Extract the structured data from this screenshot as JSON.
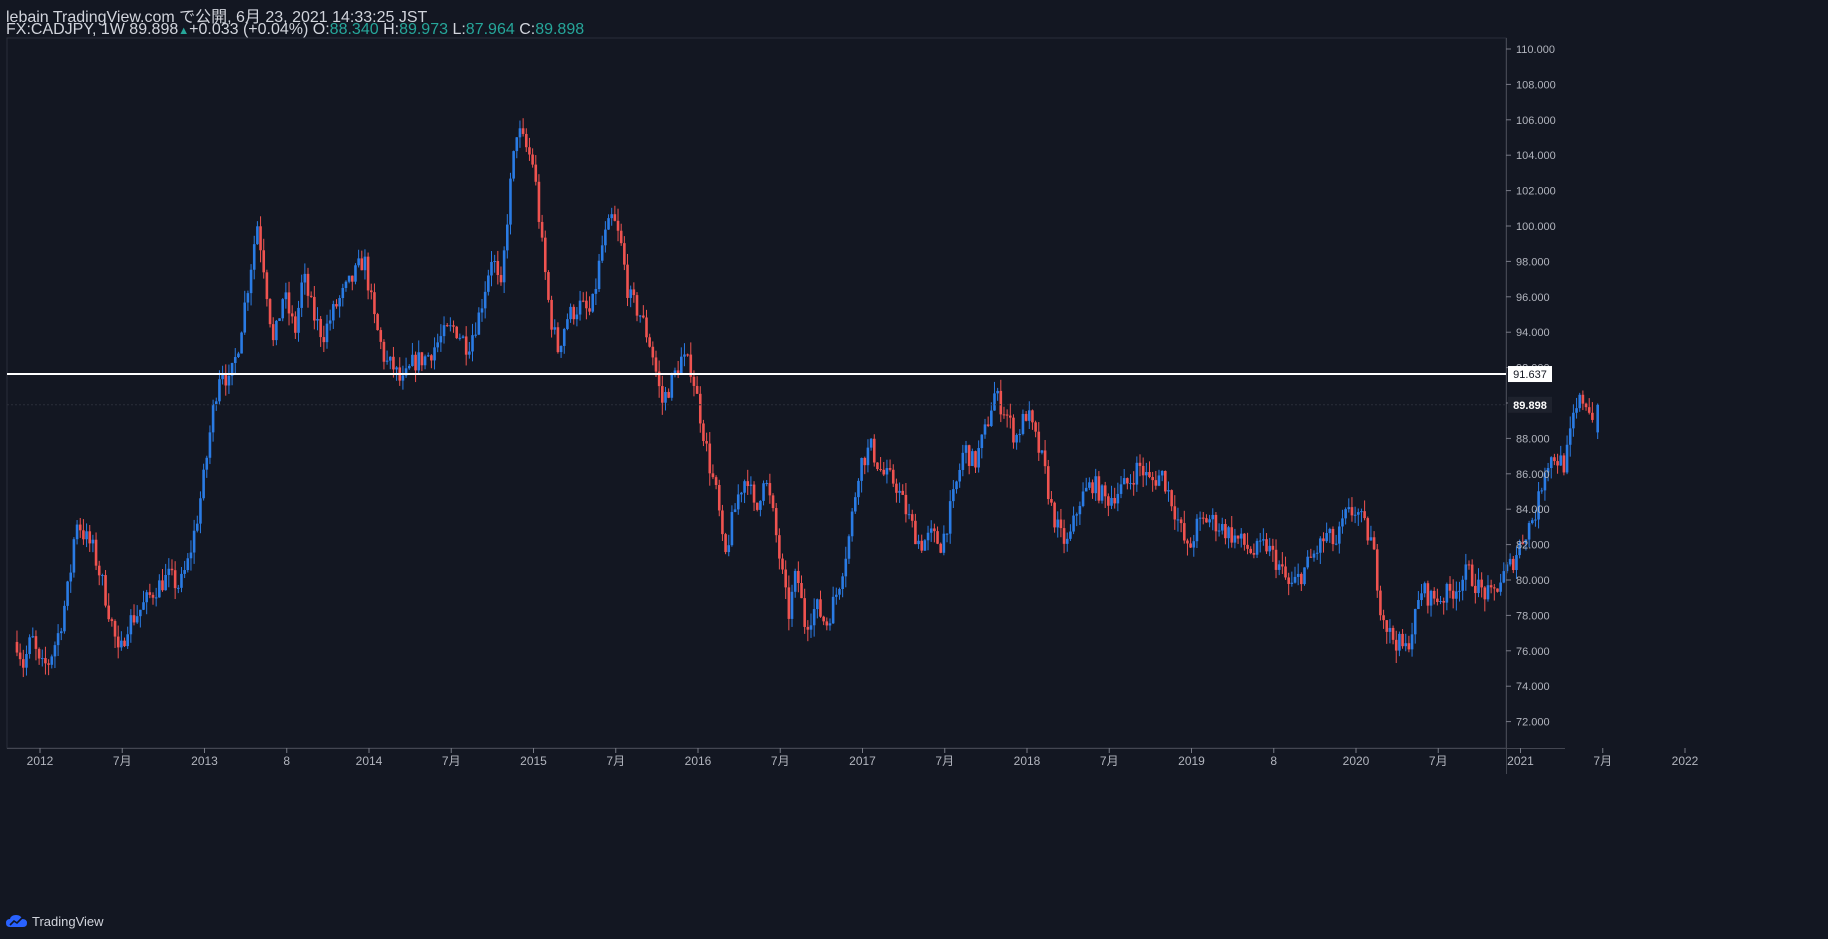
{
  "header": {
    "line1": "lebain TradingView.com で公開, 6月 23, 2021 14:33:25 JST",
    "symbol": "FX:CADJPY, 1W",
    "last": "89.898",
    "change": "+0.033 (+0.04%)",
    "o_label": "O:",
    "o": "88.340",
    "h_label": "H:",
    "h": "89.973",
    "l_label": "L:",
    "l": "87.964",
    "c_label": "C:",
    "c": "89.898"
  },
  "footer": {
    "brand": "TradingView"
  },
  "colors": {
    "background": "#131722",
    "up": "#2a7be4",
    "down": "#ef5350",
    "text": "#d1d4dc",
    "value": "#26a69a",
    "hline": "#ffffff"
  },
  "chart_data": {
    "type": "candlestick",
    "symbol": "FX:CADJPY",
    "interval": "1W",
    "ylim": [
      70,
      111
    ],
    "y_ticks": [
      "72.000",
      "74.000",
      "76.000",
      "78.000",
      "80.000",
      "82.000",
      "84.000",
      "86.000",
      "88.000",
      "90.000",
      "92.000",
      "94.000",
      "96.000",
      "98.000",
      "100.000",
      "102.000",
      "104.000",
      "106.000",
      "108.000",
      "110.000"
    ],
    "x_ticks": [
      {
        "label": "2012",
        "x": 2012.0
      },
      {
        "label": "7月",
        "x": 2012.5
      },
      {
        "label": "2013",
        "x": 2013.0
      },
      {
        "label": "8",
        "x": 2013.5
      },
      {
        "label": "2014",
        "x": 2014.0
      },
      {
        "label": "7月",
        "x": 2014.5
      },
      {
        "label": "2015",
        "x": 2015.0
      },
      {
        "label": "7月",
        "x": 2015.5
      },
      {
        "label": "2016",
        "x": 2016.0
      },
      {
        "label": "7月",
        "x": 2016.5
      },
      {
        "label": "2017",
        "x": 2017.0
      },
      {
        "label": "7月",
        "x": 2017.5
      },
      {
        "label": "2018",
        "x": 2018.0
      },
      {
        "label": "7月",
        "x": 2018.5
      },
      {
        "label": "2019",
        "x": 2019.0
      },
      {
        "label": "8",
        "x": 2019.5
      },
      {
        "label": "2020",
        "x": 2020.0
      },
      {
        "label": "7月",
        "x": 2020.5
      },
      {
        "label": "2021",
        "x": 2021.0
      },
      {
        "label": "7月",
        "x": 2021.5
      },
      {
        "label": "2022",
        "x": 2022.0
      }
    ],
    "horizontal_line": {
      "value": 91.637,
      "label": "91.637"
    },
    "last_price": {
      "value": 89.898,
      "label": "89.898"
    },
    "path": [
      [
        2011.86,
        76.5
      ],
      [
        2011.9,
        75.2
      ],
      [
        2011.95,
        76.8
      ],
      [
        2012.0,
        75.0
      ],
      [
        2012.05,
        75.3
      ],
      [
        2012.12,
        77.2
      ],
      [
        2012.18,
        80.0
      ],
      [
        2012.22,
        83.5
      ],
      [
        2012.27,
        82.5
      ],
      [
        2012.32,
        81.8
      ],
      [
        2012.38,
        79.8
      ],
      [
        2012.45,
        77.0
      ],
      [
        2012.48,
        75.5
      ],
      [
        2012.53,
        77.5
      ],
      [
        2012.6,
        78.2
      ],
      [
        2012.7,
        79.5
      ],
      [
        2012.78,
        80.2
      ],
      [
        2012.85,
        79.6
      ],
      [
        2012.9,
        81.0
      ],
      [
        2012.95,
        83.2
      ],
      [
        2013.0,
        86.0
      ],
      [
        2013.05,
        89.5
      ],
      [
        2013.1,
        92.2
      ],
      [
        2013.15,
        91.0
      ],
      [
        2013.2,
        93.0
      ],
      [
        2013.27,
        97.0
      ],
      [
        2013.32,
        100.2
      ],
      [
        2013.36,
        97.8
      ],
      [
        2013.42,
        93.2
      ],
      [
        2013.48,
        96.2
      ],
      [
        2013.55,
        94.0
      ],
      [
        2013.6,
        97.2
      ],
      [
        2013.66,
        95.0
      ],
      [
        2013.72,
        93.8
      ],
      [
        2013.8,
        95.5
      ],
      [
        2013.9,
        97.0
      ],
      [
        2013.97,
        98.2
      ],
      [
        2014.03,
        94.8
      ],
      [
        2014.1,
        92.3
      ],
      [
        2014.15,
        92.0
      ],
      [
        2014.2,
        91.0
      ],
      [
        2014.27,
        92.3
      ],
      [
        2014.35,
        92.6
      ],
      [
        2014.45,
        93.8
      ],
      [
        2014.52,
        94.3
      ],
      [
        2014.6,
        93.2
      ],
      [
        2014.67,
        95.0
      ],
      [
        2014.75,
        98.5
      ],
      [
        2014.8,
        96.0
      ],
      [
        2014.85,
        101.5
      ],
      [
        2014.9,
        105.5
      ],
      [
        2014.95,
        104.5
      ],
      [
        2015.0,
        103.5
      ],
      [
        2015.05,
        99.0
      ],
      [
        2015.1,
        95.0
      ],
      [
        2015.15,
        93.0
      ],
      [
        2015.2,
        94.8
      ],
      [
        2015.28,
        95.5
      ],
      [
        2015.35,
        95.0
      ],
      [
        2015.42,
        99.0
      ],
      [
        2015.48,
        100.5
      ],
      [
        2015.53,
        99.0
      ],
      [
        2015.58,
        96.0
      ],
      [
        2015.65,
        95.0
      ],
      [
        2015.72,
        93.0
      ],
      [
        2015.78,
        90.0
      ],
      [
        2015.83,
        91.0
      ],
      [
        2015.9,
        92.5
      ],
      [
        2015.96,
        92.0
      ],
      [
        2016.02,
        89.0
      ],
      [
        2016.07,
        86.5
      ],
      [
        2016.12,
        84.5
      ],
      [
        2016.16,
        81.0
      ],
      [
        2016.2,
        83.0
      ],
      [
        2016.25,
        85.0
      ],
      [
        2016.3,
        86.0
      ],
      [
        2016.35,
        83.5
      ],
      [
        2016.4,
        86.0
      ],
      [
        2016.45,
        84.0
      ],
      [
        2016.5,
        81.0
      ],
      [
        2016.55,
        78.0
      ],
      [
        2016.6,
        80.5
      ],
      [
        2016.65,
        77.5
      ],
      [
        2016.72,
        78.5
      ],
      [
        2016.78,
        77.5
      ],
      [
        2016.85,
        79.5
      ],
      [
        2016.92,
        82.5
      ],
      [
        2016.98,
        86.5
      ],
      [
        2017.05,
        87.5
      ],
      [
        2017.12,
        86.0
      ],
      [
        2017.2,
        85.5
      ],
      [
        2017.28,
        83.5
      ],
      [
        2017.35,
        82.0
      ],
      [
        2017.42,
        82.5
      ],
      [
        2017.48,
        82.0
      ],
      [
        2017.55,
        84.5
      ],
      [
        2017.62,
        87.5
      ],
      [
        2017.68,
        86.5
      ],
      [
        2017.75,
        88.5
      ],
      [
        2017.8,
        90.5
      ],
      [
        2017.87,
        89.5
      ],
      [
        2017.93,
        88.0
      ],
      [
        2018.0,
        89.5
      ],
      [
        2018.05,
        88.0
      ],
      [
        2018.1,
        86.5
      ],
      [
        2018.15,
        84.0
      ],
      [
        2018.2,
        82.5
      ],
      [
        2018.25,
        82.0
      ],
      [
        2018.32,
        84.5
      ],
      [
        2018.4,
        85.5
      ],
      [
        2018.48,
        84.5
      ],
      [
        2018.55,
        85.0
      ],
      [
        2018.62,
        85.5
      ],
      [
        2018.68,
        86.5
      ],
      [
        2018.75,
        85.5
      ],
      [
        2018.82,
        86.0
      ],
      [
        2018.88,
        84.5
      ],
      [
        2018.93,
        83.0
      ],
      [
        2018.98,
        81.5
      ],
      [
        2019.03,
        83.0
      ],
      [
        2019.1,
        83.5
      ],
      [
        2019.18,
        83.0
      ],
      [
        2019.25,
        82.5
      ],
      [
        2019.32,
        82.0
      ],
      [
        2019.38,
        81.5
      ],
      [
        2019.45,
        82.0
      ],
      [
        2019.52,
        81.0
      ],
      [
        2019.6,
        79.5
      ],
      [
        2019.68,
        80.5
      ],
      [
        2019.75,
        81.5
      ],
      [
        2019.82,
        82.5
      ],
      [
        2019.88,
        82.0
      ],
      [
        2019.93,
        83.5
      ],
      [
        2020.0,
        84.0
      ],
      [
        2020.05,
        83.0
      ],
      [
        2020.1,
        82.0
      ],
      [
        2020.15,
        78.5
      ],
      [
        2020.2,
        77.0
      ],
      [
        2020.25,
        76.5
      ],
      [
        2020.3,
        76.0
      ],
      [
        2020.35,
        77.5
      ],
      [
        2020.4,
        79.5
      ],
      [
        2020.45,
        79.0
      ],
      [
        2020.52,
        79.0
      ],
      [
        2020.6,
        79.5
      ],
      [
        2020.68,
        80.5
      ],
      [
        2020.75,
        79.5
      ],
      [
        2020.82,
        79.0
      ],
      [
        2020.88,
        80.0
      ],
      [
        2020.95,
        81.0
      ],
      [
        2021.02,
        82.5
      ],
      [
        2021.1,
        84.0
      ],
      [
        2021.15,
        86.5
      ],
      [
        2021.2,
        87.0
      ],
      [
        2021.27,
        86.5
      ],
      [
        2021.32,
        89.0
      ],
      [
        2021.37,
        90.3
      ],
      [
        2021.42,
        89.8
      ],
      [
        2021.45,
        88.5
      ]
    ]
  }
}
